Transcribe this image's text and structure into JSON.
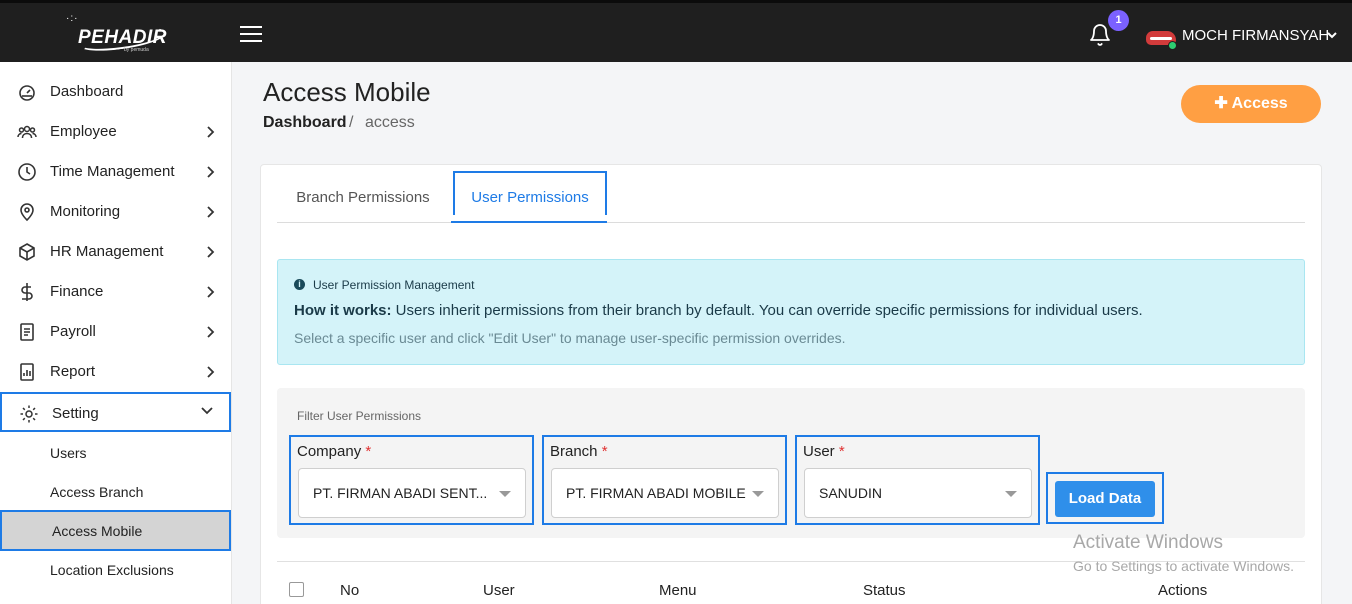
{
  "header": {
    "logo_text": "PEHADIR",
    "logo_sub": "by pemuda",
    "notification_count": "1",
    "user_name": "MOCH FIRMANSYAH"
  },
  "sidebar": {
    "items": [
      {
        "label": "Dashboard",
        "icon": "dashboard-icon"
      },
      {
        "label": "Employee",
        "icon": "employee-icon"
      },
      {
        "label": "Time Management",
        "icon": "clock-icon"
      },
      {
        "label": "Monitoring",
        "icon": "location-pin-icon"
      },
      {
        "label": "HR Management",
        "icon": "cube-icon"
      },
      {
        "label": "Finance",
        "icon": "dollar-icon"
      },
      {
        "label": "Payroll",
        "icon": "document-icon"
      },
      {
        "label": "Report",
        "icon": "report-icon"
      },
      {
        "label": "Setting",
        "icon": "gear-icon"
      }
    ],
    "sub_items": [
      {
        "label": "Users"
      },
      {
        "label": "Access Branch"
      },
      {
        "label": "Access Mobile"
      },
      {
        "label": "Location Exclusions"
      }
    ]
  },
  "page": {
    "title": "Access Mobile",
    "breadcrumb_home": "Dashboard",
    "breadcrumb_sep": "/",
    "breadcrumb_current": "access",
    "access_button": "Access"
  },
  "tabs": {
    "branch": "Branch Permissions",
    "user": "User Permissions"
  },
  "info": {
    "title": "User Permission Management",
    "how_label": "How it works:",
    "how_text": " Users inherit permissions from their branch by default. You can override specific permissions for individual users.",
    "hint": "Select a specific user and click \"Edit User\" to manage user-specific permission overrides."
  },
  "filter": {
    "title": "Filter User Permissions",
    "company_label": "Company",
    "company_value": "PT. FIRMAN ABADI SENT...",
    "branch_label": "Branch",
    "branch_value": "PT. FIRMAN ABADI MOBILE",
    "user_label": "User",
    "user_value": "SANUDIN",
    "required_mark": "*",
    "load_button": "Load Data"
  },
  "table": {
    "columns": [
      "No",
      "User",
      "Menu",
      "Status",
      "Actions"
    ]
  },
  "watermark": {
    "line1": "Activate Windows",
    "line2": "Go to Settings to activate Windows."
  },
  "colors": {
    "topbar": "#1f1f1f",
    "accent": "#1e7be6",
    "access_button": "#ff9f43",
    "info_bg": "#d4f3f9",
    "badge": "#7b61ff"
  }
}
